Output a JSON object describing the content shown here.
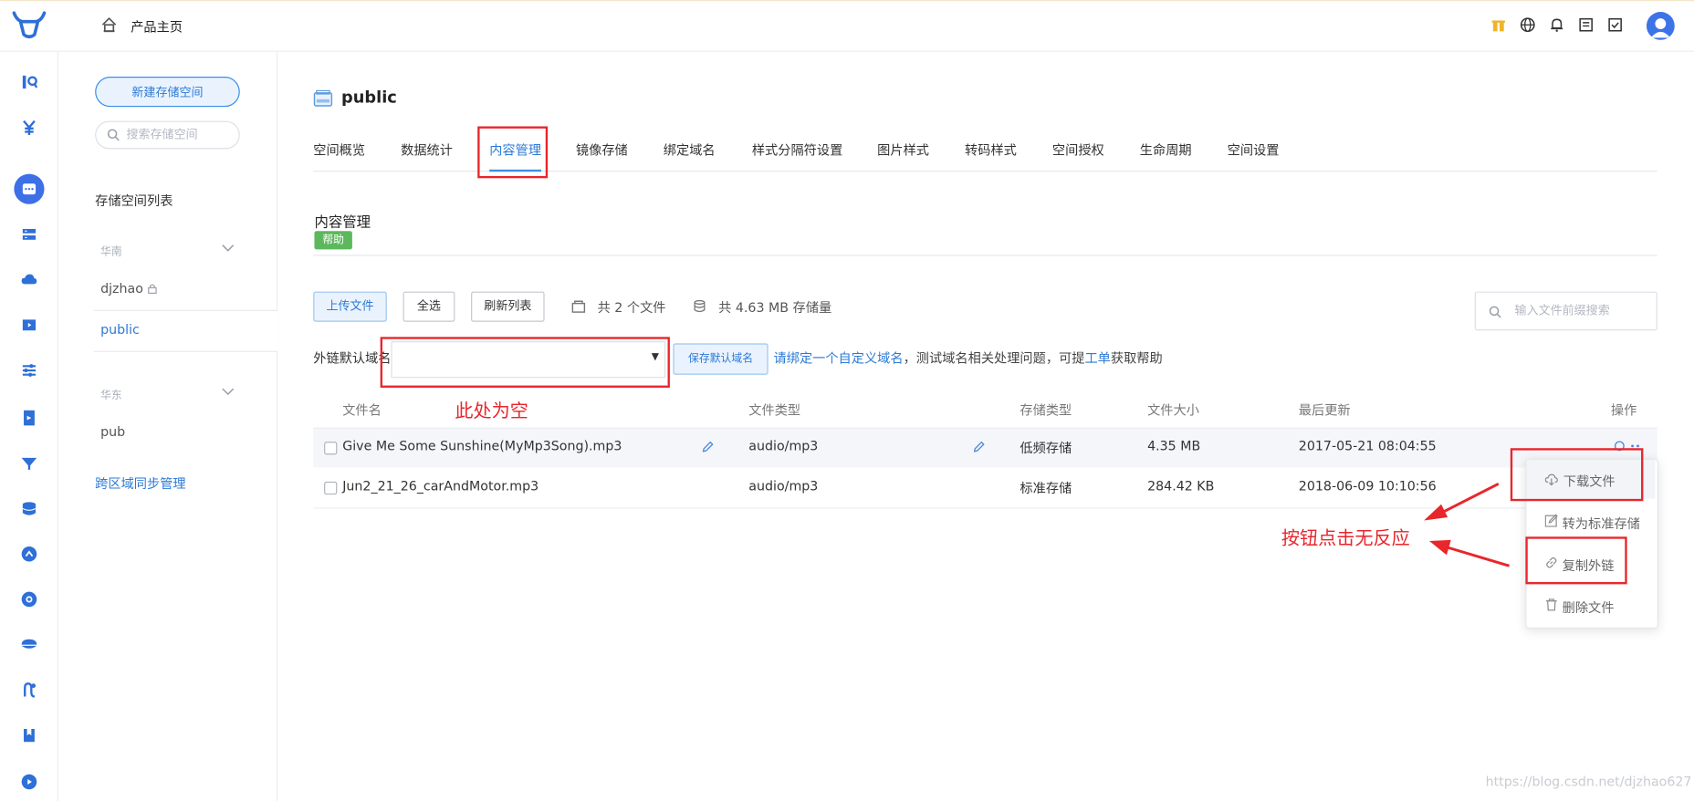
{
  "topbar": {
    "home_label": "产品主页",
    "icons": [
      "gift-icon",
      "globe-icon",
      "bell-icon",
      "document-icon",
      "checkbox-icon"
    ]
  },
  "rail": {
    "icons": [
      "chart-icon",
      "yuan-icon",
      "storage-icon",
      "server-icon",
      "cloud-icon",
      "film-icon",
      "sliders-icon",
      "doc-icon",
      "funnel-icon",
      "database-icon",
      "gauge-icon",
      "play-icon",
      "dish-icon",
      "link-icon",
      "book-icon",
      "media-icon"
    ]
  },
  "panel2": {
    "new_button": "新建存储空间",
    "search_placeholder": "搜索存储空间",
    "list_title": "存储空间列表",
    "region1": "华南",
    "bucket1": "djzhao",
    "bucket2": "public",
    "region2": "华东",
    "bucket3": "pub",
    "cross_region_link": "跨区域同步管理"
  },
  "main": {
    "bucket_title": "public",
    "tabs": [
      "空间概览",
      "数据统计",
      "内容管理",
      "镜像存储",
      "绑定域名",
      "样式分隔符设置",
      "图片样式",
      "转码样式",
      "空间授权",
      "生命周期",
      "空间设置"
    ],
    "active_tab": "内容管理",
    "section_title": "内容管理",
    "help_badge": "帮助",
    "upload_button": "上传文件",
    "select_all_button": "全选",
    "refresh_button": "刷新列表",
    "file_count": "共 2 个文件",
    "storage_total": "共 4.63 MB 存储量",
    "search_placeholder": "输入文件前缀搜索",
    "domain_label": "外链默认域名",
    "domain_value": "",
    "save_domain_button": "保存默认域名",
    "hint_link": "请绑定一个自定义域名",
    "hint_text_1": "，测试域名相关处理问题，可提",
    "hint_link_2": "工单",
    "hint_text_2": "获取帮助"
  },
  "table": {
    "columns": [
      "文件名",
      "文件类型",
      "存储类型",
      "文件大小",
      "最后更新",
      "操作"
    ],
    "rows": [
      {
        "name": "Give Me Some Sunshine(MyMp3Song).mp3",
        "type": "audio/mp3",
        "storage": "低频存储",
        "size": "4.35 MB",
        "updated": "2017-05-21 08:04:55"
      },
      {
        "name": "Jun2_21_26_carAndMotor.mp3",
        "type": "audio/mp3",
        "storage": "标准存储",
        "size": "284.42 KB",
        "updated": "2018-06-09 10:10:56"
      }
    ]
  },
  "menu": {
    "download": "下载文件",
    "convert": "转为标准存储",
    "copy_link": "复制外链",
    "delete": "删除文件"
  },
  "annotations": {
    "empty_note": "此处为空",
    "no_response_note": "按钮点击无反应"
  },
  "watermark": "https://blog.csdn.net/djzhao627",
  "colors": {
    "accent": "#2d7ad6",
    "annotation_red": "#e8262b",
    "help_green": "#5cb85c"
  }
}
